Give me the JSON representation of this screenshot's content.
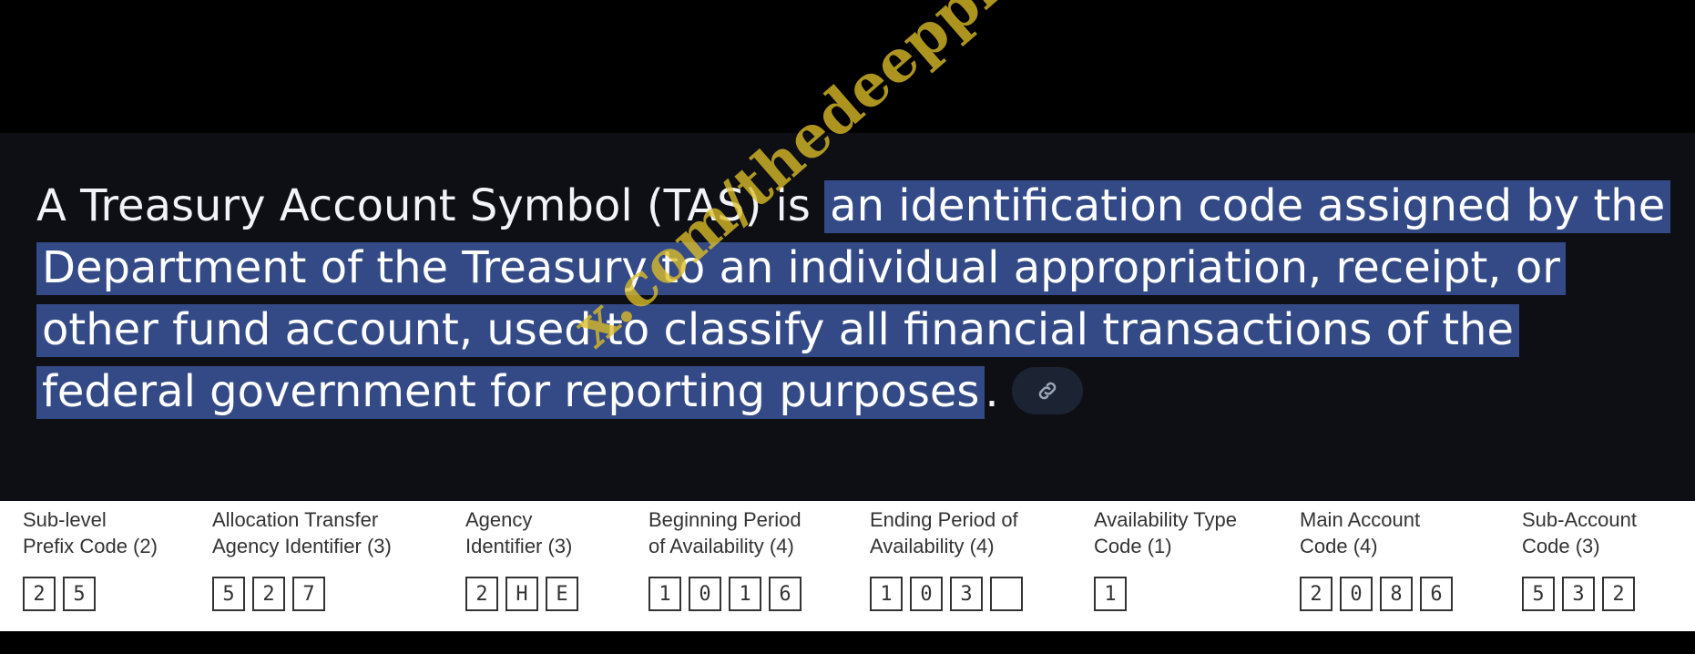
{
  "answer": {
    "plain_start": "A Treasury Account Symbol (TAS) is ",
    "highlighted": "an identification code assigned by the Department of the Treasury to an individual appropriation, receipt, or other fund account, used to classify all financial transactions of the federal government for reporting purposes",
    "plain_end": "."
  },
  "icons": {
    "link": "link-icon"
  },
  "colors": {
    "highlight": "#334a86",
    "panel": "#0e0f15",
    "watermark": "#ddbe28"
  },
  "tas_form": {
    "fields": [
      {
        "label": "Sub-level\nPrefix Code (2)",
        "chars": [
          "2",
          "5"
        ]
      },
      {
        "label": "Allocation Transfer\nAgency Identifier (3)",
        "chars": [
          "5",
          "2",
          "7"
        ]
      },
      {
        "label": "Agency\nIdentifier (3)",
        "chars": [
          "2",
          "H",
          "E"
        ]
      },
      {
        "label": "Beginning Period\nof Availability (4)",
        "chars": [
          "1",
          "0",
          "1",
          "6"
        ]
      },
      {
        "label": "Ending Period of\nAvailability (4)",
        "chars": [
          "1",
          "0",
          "3",
          ""
        ]
      },
      {
        "label": "Availability Type\nCode (1)",
        "chars": [
          "1"
        ]
      },
      {
        "label": "Main Account\nCode (4)",
        "chars": [
          "2",
          "0",
          "8",
          "6"
        ]
      },
      {
        "label": "Sub-Account\nCode (3)",
        "chars": [
          "5",
          "3",
          "2"
        ]
      }
    ]
  },
  "watermark": {
    "text": "x.com/thedeeppicture"
  }
}
